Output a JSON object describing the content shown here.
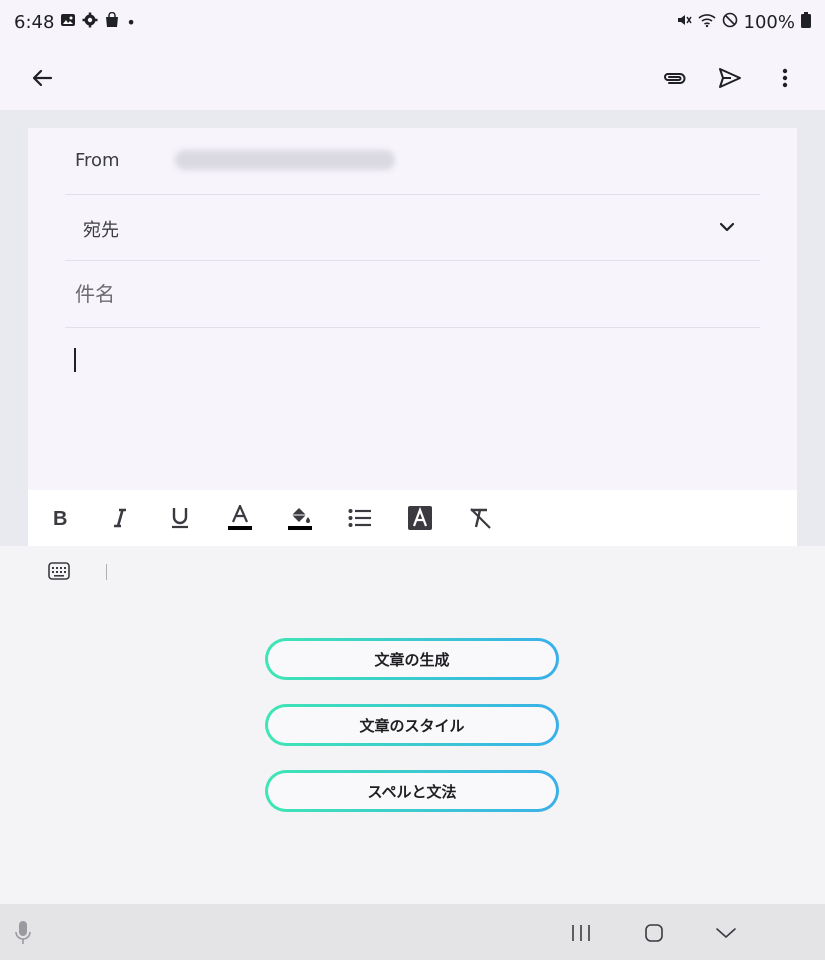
{
  "status": {
    "time": "6:48",
    "icons_left": [
      "image-icon",
      "settings-icon",
      "shopping-bag-icon",
      "dot-icon"
    ],
    "icons_right": [
      "mute-icon",
      "wifi-icon",
      "do-not-disturb-icon",
      "battery-icon"
    ],
    "battery": "100%"
  },
  "appbar": {
    "icons": [
      "back-arrow-icon",
      "attach-icon",
      "send-icon",
      "more-icon"
    ]
  },
  "compose": {
    "from_label": "From",
    "to_label": "宛先",
    "subject_placeholder": "件名"
  },
  "format_toolbar": {
    "items": [
      "bold",
      "italic",
      "underline",
      "text-color",
      "highlight",
      "bulleted-list",
      "text-style",
      "clear-formatting"
    ]
  },
  "keyboard_panel": {
    "buttons": [
      "文章の生成",
      "文章のスタイル",
      "スペルと文法"
    ],
    "accent_from": "#3ee6b3",
    "accent_to": "#3ab0ea"
  },
  "navbar": {
    "icons": [
      "microphone-icon",
      "recents-icon",
      "home-icon",
      "hide-keyboard-icon"
    ]
  }
}
